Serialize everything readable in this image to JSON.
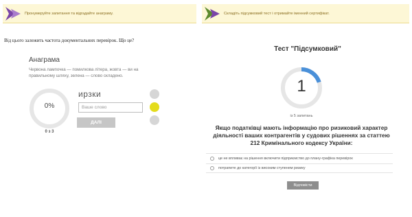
{
  "left_panel": {
    "banner_text": "Пронумеруйте запитання та відгадайте анаграму.",
    "question": "Від цього залежить частота документальних перевірок. Що це?",
    "anagram": {
      "title": "Анаграма",
      "description": "Червона лампочка — помилкова літера, жовта — ви на правильному шляху, зелена — слово складено.",
      "progress_value": "0%",
      "progress_fraction": 0,
      "counter": "0 з 3",
      "letters": "ирзки",
      "input_value": "",
      "input_placeholder": "Ваше слово",
      "next_label": "ДАЛІ",
      "status_dots": [
        {
          "state": "inactive",
          "color": "#d6d6d6"
        },
        {
          "state": "active",
          "color": "#e4dc1c"
        },
        {
          "state": "inactive",
          "color": "#d6d6d6"
        }
      ]
    }
  },
  "right_panel": {
    "banner_text": "Складіть підсумковий тест і отримайте іменний сертифікат.",
    "test_title": "Тест \"Підсумковий\"",
    "current_question": "1",
    "total_label": "із 5 запитань",
    "progress_fraction": 0.2,
    "question": "Якщо податківці мають інформацію про ризиковий характер діяльності ваших контрагентів у судових рішеннях за статтею 212 Кримінального кодексу України:",
    "options": [
      "це не впливає на рішення включити підприємство до плану-графіка перевірок",
      "потрапите до категорії із високим ступенем ризику"
    ],
    "answer_label": "Відповісти"
  },
  "colors": {
    "banner_bg": "#fdf7d6",
    "banner_text": "#8a6d1f",
    "logo_arrow": "#7a45a8",
    "ring_track": "#e6e6e6",
    "ring_progress": "#4a90d9",
    "dot_active": "#e4dc1c",
    "dot_inactive": "#d6d6d6",
    "next_button": "#c6c6c6",
    "answer_button": "#8e8e8e"
  },
  "icons": {
    "banner_logo": "purple-arrow-logo-icon"
  }
}
